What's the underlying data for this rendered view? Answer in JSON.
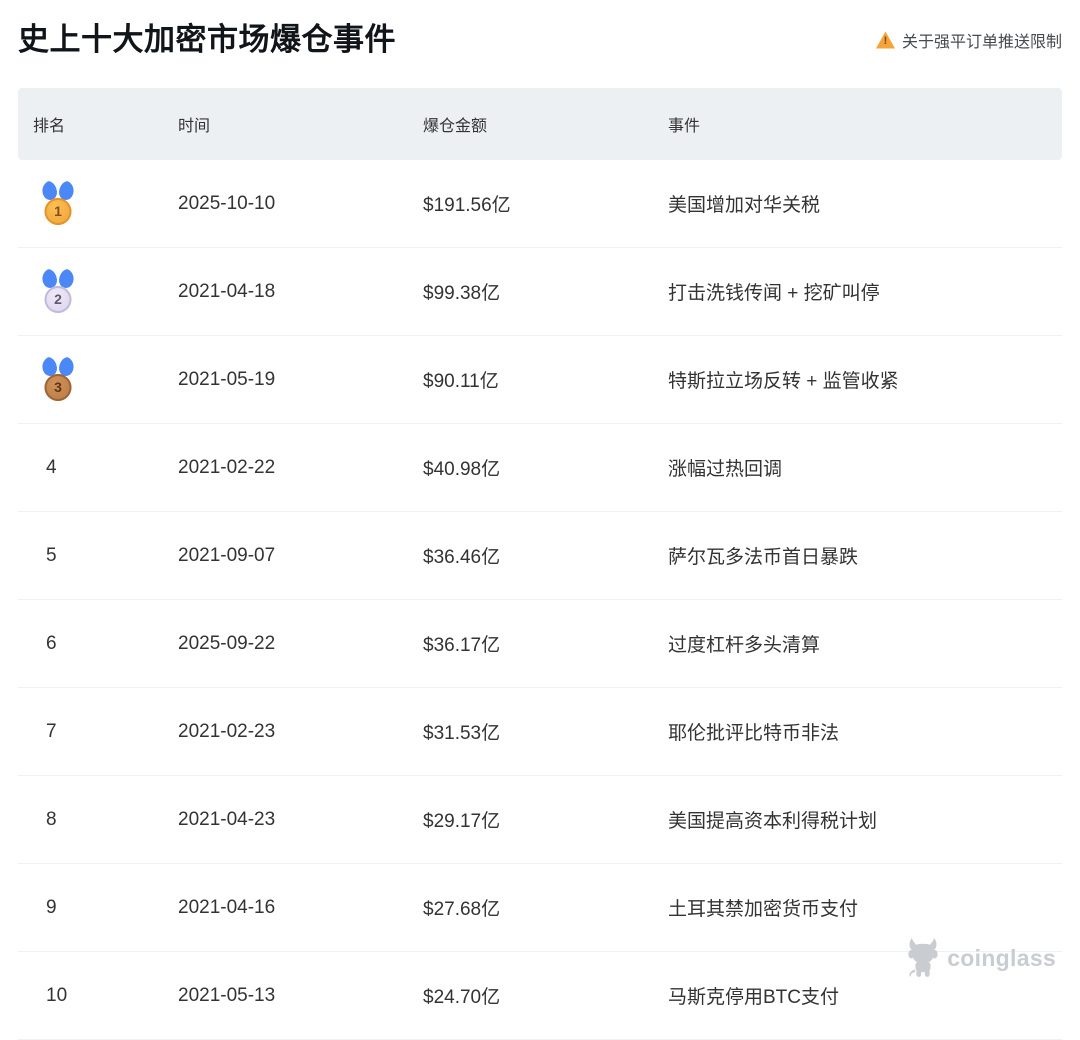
{
  "page": {
    "title": "史上十大加密市场爆仓事件",
    "notice_label": "关于强平订单推送限制",
    "warning_mark": "!"
  },
  "table": {
    "headers": [
      "排名",
      "时间",
      "爆仓金额",
      "事件"
    ],
    "rows": [
      {
        "rank": "1",
        "medal": "gold",
        "date": "2025-10-10",
        "amount": "$191.56亿",
        "event": "美国增加对华关税"
      },
      {
        "rank": "2",
        "medal": "silver",
        "date": "2021-04-18",
        "amount": "$99.38亿",
        "event": "打击洗钱传闻 + 挖矿叫停"
      },
      {
        "rank": "3",
        "medal": "bronze",
        "date": "2021-05-19",
        "amount": "$90.11亿",
        "event": "特斯拉立场反转 + 监管收紧"
      },
      {
        "rank": "4",
        "medal": null,
        "date": "2021-02-22",
        "amount": "$40.98亿",
        "event": "涨幅过热回调"
      },
      {
        "rank": "5",
        "medal": null,
        "date": "2021-09-07",
        "amount": "$36.46亿",
        "event": "萨尔瓦多法币首日暴跌"
      },
      {
        "rank": "6",
        "medal": null,
        "date": "2025-09-22",
        "amount": "$36.17亿",
        "event": "过度杠杆多头清算"
      },
      {
        "rank": "7",
        "medal": null,
        "date": "2021-02-23",
        "amount": "$31.53亿",
        "event": "耶伦批评比特币非法"
      },
      {
        "rank": "8",
        "medal": null,
        "date": "2021-04-23",
        "amount": "$29.17亿",
        "event": "美国提高资本利得税计划"
      },
      {
        "rank": "9",
        "medal": null,
        "date": "2021-04-16",
        "amount": "$27.68亿",
        "event": "土耳其禁加密货币支付"
      },
      {
        "rank": "10",
        "medal": null,
        "date": "2021-05-13",
        "amount": "$24.70亿",
        "event": "马斯克停用BTC支付"
      }
    ]
  },
  "watermark": {
    "brand": "coinglass",
    "icon": "bull-mascot"
  },
  "colors": {
    "header_bg": "#edf0f3",
    "divider": "#f0f1f2",
    "text": "#333333",
    "title": "#111418",
    "warning_orange": "#f5a537",
    "ribbon_blue": "#4b87f5",
    "watermark_gray": "#c9ccd0"
  }
}
